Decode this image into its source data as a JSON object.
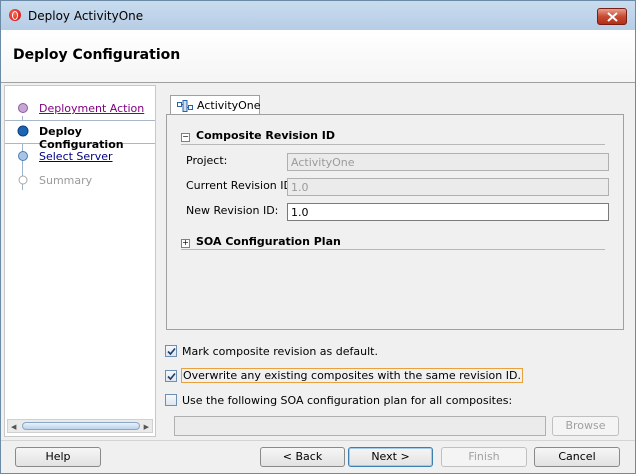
{
  "window": {
    "title": "Deploy ActivityOne"
  },
  "header": {
    "title": "Deploy Configuration"
  },
  "steps": [
    {
      "label": "Deployment Action",
      "state": "visited"
    },
    {
      "label": "Deploy Configuration",
      "state": "current"
    },
    {
      "label": "Select Server",
      "state": "link"
    },
    {
      "label": "Summary",
      "state": "disabled"
    }
  ],
  "tab": {
    "label": "ActivityOne"
  },
  "composite": {
    "section_title": "Composite Revision ID",
    "project_label": "Project:",
    "project_value": "ActivityOne",
    "current_label": "Current Revision ID:",
    "current_value": "1.0",
    "new_label": "New Revision ID:",
    "new_value": "1.0"
  },
  "soa_plan": {
    "section_title": "SOA Configuration Plan"
  },
  "options": {
    "mark_default": {
      "label": "Mark composite revision as default.",
      "checked": true
    },
    "overwrite": {
      "label": "Overwrite any existing composites with the same revision ID.",
      "checked": true
    },
    "use_plan": {
      "label": "Use the following SOA configuration plan for all composites:",
      "checked": false
    },
    "plan_path": ""
  },
  "buttons": {
    "browse": "Browse",
    "help": "Help",
    "back": "< Back",
    "next": "Next >",
    "finish": "Finish",
    "cancel": "Cancel"
  }
}
